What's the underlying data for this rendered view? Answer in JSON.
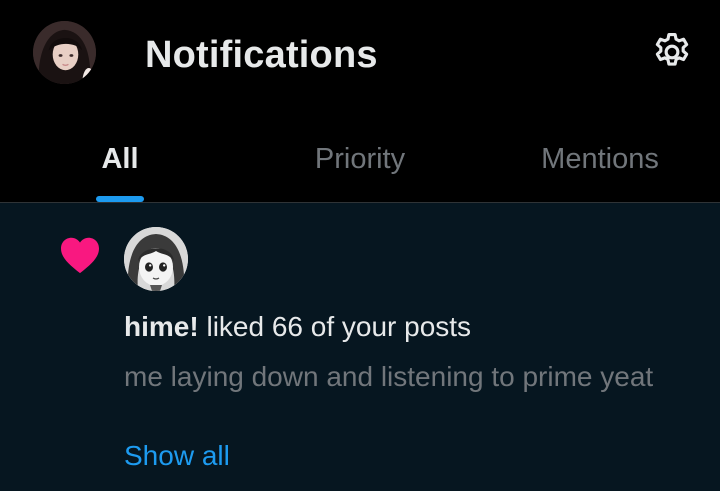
{
  "header": {
    "title": "Notifications",
    "avatar_icon": "profile-avatar",
    "settings_icon": "gear-icon"
  },
  "tabs": [
    {
      "label": "All",
      "active": true
    },
    {
      "label": "Priority",
      "active": false
    },
    {
      "label": "Mentions",
      "active": false
    }
  ],
  "notification": {
    "type_icon": "heart-icon",
    "user": "hime!",
    "action": " liked 66 of your posts",
    "preview": "me laying down and listening to prime yeat",
    "show_all": "Show all"
  },
  "colors": {
    "background": "#000000",
    "notification_bg": "#061620",
    "accent": "#1d9bf0",
    "heart": "#f91880",
    "text_primary": "#e7e9ea",
    "text_secondary": "#71767b"
  }
}
